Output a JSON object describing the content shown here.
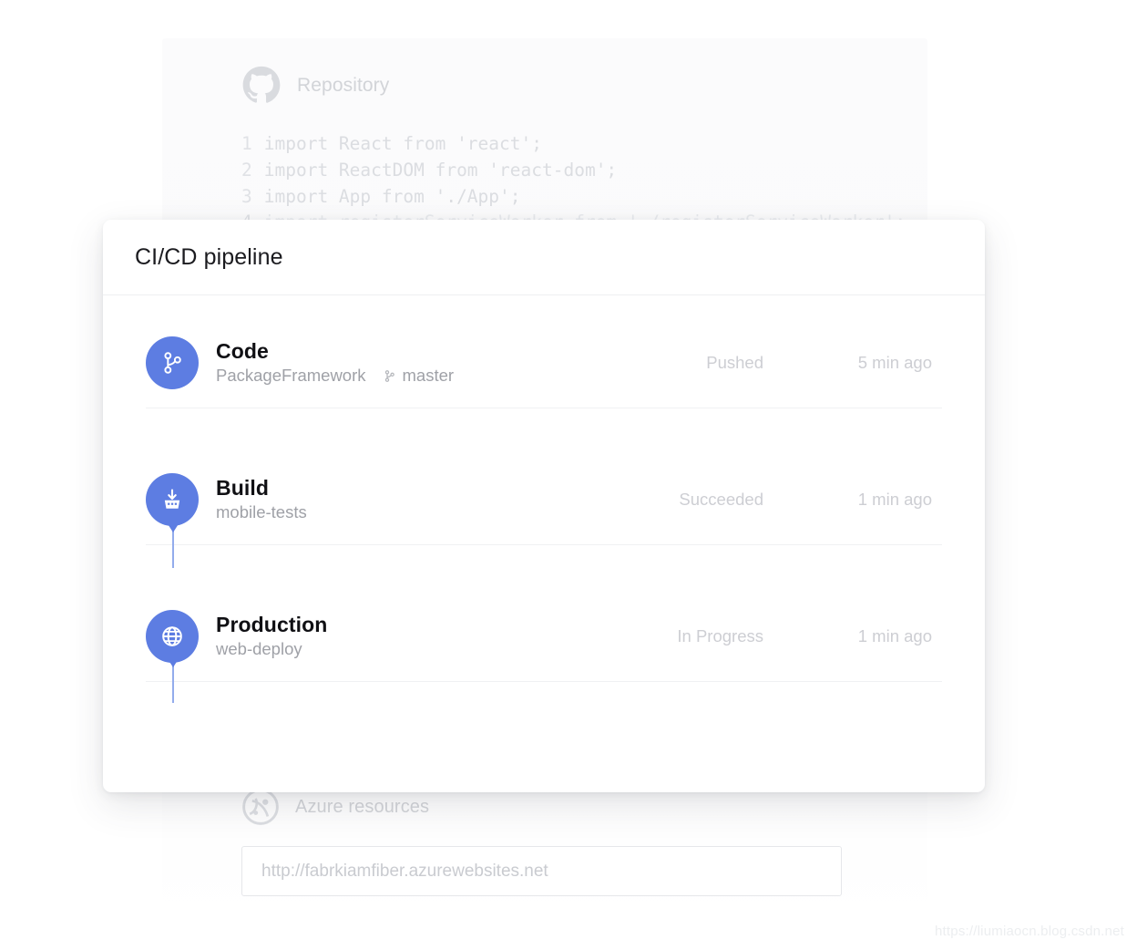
{
  "background": {
    "repository": {
      "label": "Repository",
      "icon": "github-icon",
      "code_lines": [
        {
          "number": "1",
          "text": "import React from 'react';"
        },
        {
          "number": "2",
          "text": "import ReactDOM from 'react-dom';"
        },
        {
          "number": "3",
          "text": "import App from './App';"
        },
        {
          "number": "4",
          "text": "import registerServiceWorker from './registerServiceWorker';"
        }
      ]
    },
    "azure": {
      "label": "Azure resources",
      "icon": "azure-icon",
      "url_value": "http://fabrkiamfiber.azurewebsites.net"
    }
  },
  "card": {
    "title": "CI/CD pipeline",
    "accent_color": "#5d7de2",
    "connector_color": "#93acec",
    "stages": [
      {
        "icon": "git-branch-icon",
        "name": "Code",
        "sub": "PackageFramework",
        "branch_icon": "git-branch-small-icon",
        "branch": "master",
        "status": "Pushed",
        "time": "5 min ago"
      },
      {
        "icon": "build-icon",
        "name": "Build",
        "sub": "mobile-tests",
        "branch_icon": "",
        "branch": "",
        "status": "Succeeded",
        "time": "1 min ago"
      },
      {
        "icon": "globe-icon",
        "name": "Production",
        "sub": "web-deploy",
        "branch_icon": "",
        "branch": "",
        "status": "In Progress",
        "time": "1 min ago"
      }
    ]
  },
  "watermark": "https://liumiaocn.blog.csdn.net"
}
